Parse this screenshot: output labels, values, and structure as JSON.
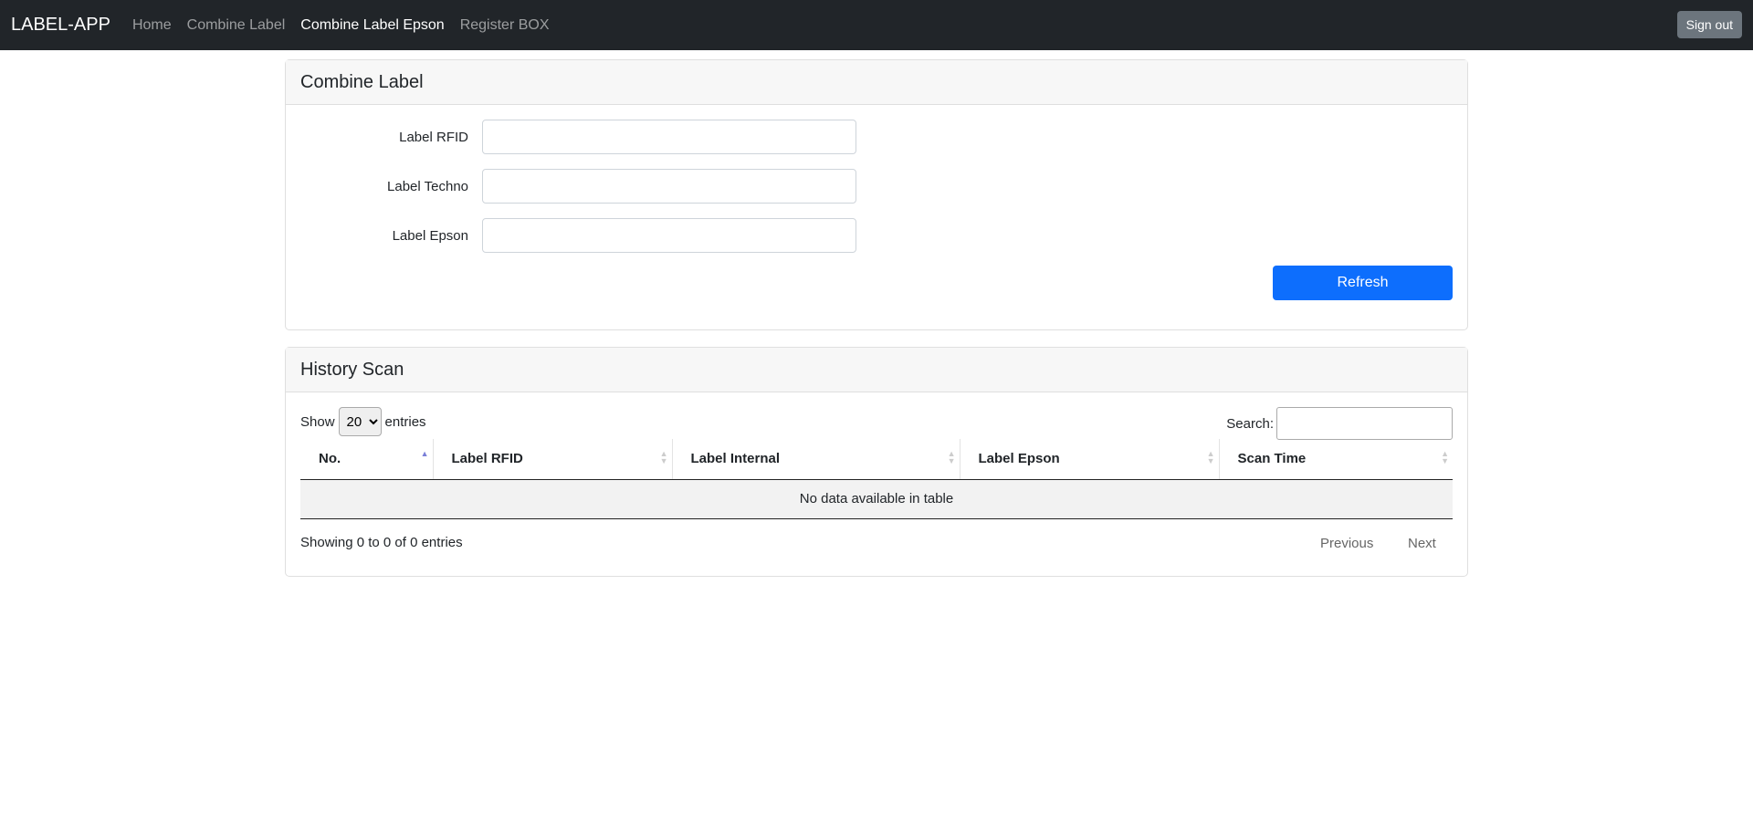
{
  "navbar": {
    "brand": "LABEL-APP",
    "links": [
      "Home",
      "Combine Label",
      "Combine Label Epson",
      "Register BOX"
    ],
    "active": "Combine Label Epson",
    "sign_out": "Sign out"
  },
  "combine": {
    "title": "Combine Label",
    "fields": [
      {
        "label": "Label RFID",
        "value": ""
      },
      {
        "label": "Label Techno",
        "value": ""
      },
      {
        "label": "Label Epson",
        "value": ""
      }
    ],
    "refresh": "Refresh"
  },
  "history": {
    "title": "History Scan",
    "show": "Show",
    "entries_value": "20",
    "entries": "entries",
    "search": "Search:",
    "search_value": "",
    "columns": [
      "No.",
      "Label RFID",
      "Label Internal",
      "Label Epson",
      "Scan Time"
    ],
    "empty": "No data available in table",
    "info": "Showing 0 to 0 of 0 entries",
    "previous": "Previous",
    "next": "Next"
  },
  "colors": {
    "navbar": "#212529",
    "primary": "#0d6efd",
    "secondary": "#6c757d"
  }
}
